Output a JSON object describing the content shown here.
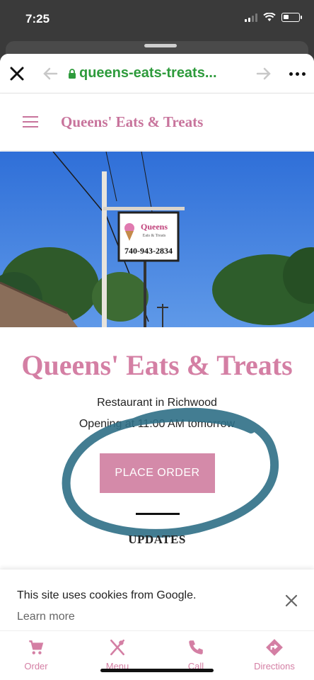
{
  "status_bar": {
    "time": "7:25"
  },
  "browser": {
    "url": "queens-eats-treats...",
    "close_icon": "close-icon",
    "back_icon": "arrow-left-icon",
    "forward_icon": "arrow-right-icon",
    "lock_icon": "lock-icon",
    "more_icon": "more-icon"
  },
  "site_header": {
    "site_name": "Queens' Eats & Treats",
    "menu_icon": "hamburger-icon"
  },
  "hero": {
    "sign_brand": "Queens",
    "sign_sub": "Eats & Treats",
    "sign_phone": "740-943-2834"
  },
  "main": {
    "title": "Queens' Eats & Treats",
    "subtitle": "Restaurant in Richwood",
    "hours": "Opening at 11:00 AM tomorrow",
    "order_button": "PLACE ORDER",
    "updates_heading": "UPDATES"
  },
  "cookie_banner": {
    "message": "This site uses cookies from Google.",
    "learn_more": "Learn more"
  },
  "bottom_nav": {
    "items": [
      {
        "label": "Order",
        "icon": "cart-icon"
      },
      {
        "label": "Menu",
        "icon": "utensils-icon"
      },
      {
        "label": "Call",
        "icon": "phone-icon"
      },
      {
        "label": "Directions",
        "icon": "directions-icon"
      }
    ]
  },
  "colors": {
    "brand_pink": "#d47fa4",
    "url_green": "#2e9b3c",
    "scribble_teal": "#2f6f86"
  }
}
